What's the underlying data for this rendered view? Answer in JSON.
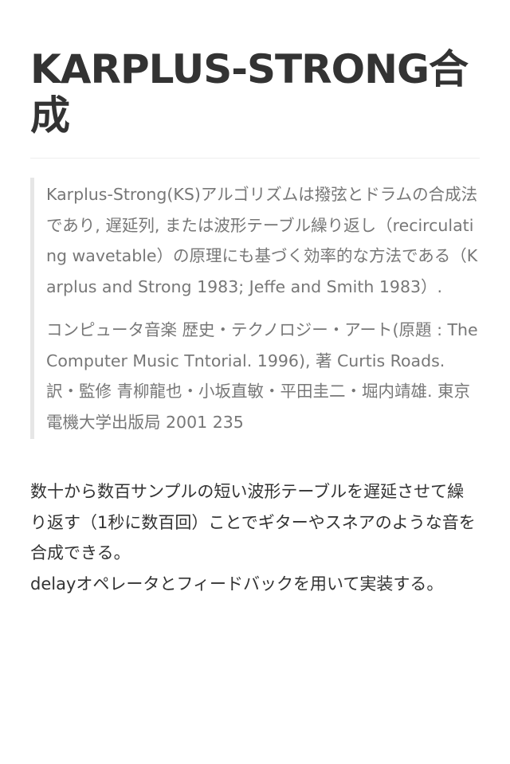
{
  "article": {
    "title": "KARPLUS-STRONG合成",
    "quote": {
      "paragraph1": "Karplus-Strong(KS)アルゴリズムは撥弦とドラムの合成法であり, 遅延列, または波形テーブル繰り返し（recirculating wavetable）の原理にも基づく効率的な方法である（Karplus and Strong 1983; Jeffe and Smith 1983）.",
      "paragraph2": "コンピュータ音楽 歴史・テクノロジー・アート(原題 : The Computer Music Tntorial. 1996), 著 Curtis Roads. 訳・監修 青柳龍也・小坂直敏・平田圭二・堀内靖雄. 東京電機大学出版局 2001 235"
    },
    "body": {
      "line1": "数十から数百サンプルの短い波形テーブルを遅延させて繰り返す（1秒に数百回）ことでギターやスネアのような音を合成できる。",
      "line2": "delayオペレータとフィードバックを用いて実装する。"
    }
  }
}
